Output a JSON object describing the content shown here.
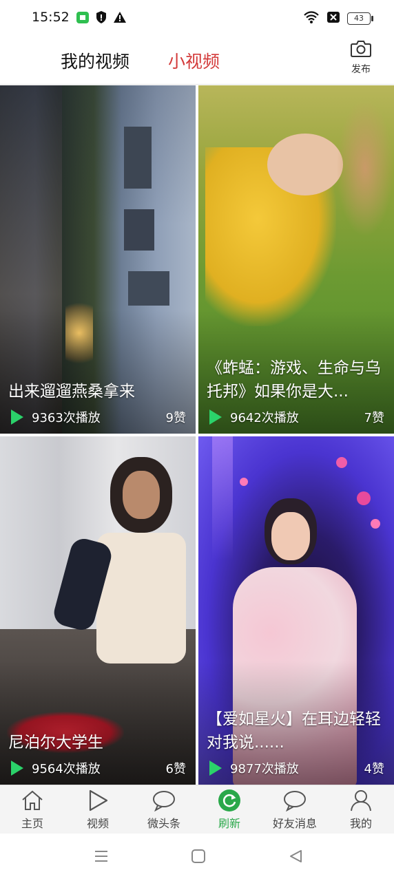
{
  "status_bar": {
    "time": "15:52",
    "battery": "43"
  },
  "header": {
    "tabs": [
      {
        "label": "我的视频",
        "active": false
      },
      {
        "label": "小视频",
        "active": true
      }
    ],
    "publish_label": "发布"
  },
  "videos": [
    {
      "title": "出来遛遛燕桑拿来",
      "plays": "9363次播放",
      "likes": "9赞"
    },
    {
      "title": "《蚱蜢：游戏、生命与乌托邦》如果你是大...",
      "plays": "9642次播放",
      "likes": "7赞"
    },
    {
      "title": "尼泊尔大学生",
      "plays": "9564次播放",
      "likes": "6赞"
    },
    {
      "title": "【爱如星火】在耳边轻轻对我说......",
      "plays": "9877次播放",
      "likes": "4赞"
    }
  ],
  "bottom_nav": [
    {
      "label": "主页",
      "icon": "home-icon"
    },
    {
      "label": "视频",
      "icon": "play-icon"
    },
    {
      "label": "微头条",
      "icon": "chat-bubble-icon"
    },
    {
      "label": "刷新",
      "icon": "refresh-icon",
      "active": true
    },
    {
      "label": "好友消息",
      "icon": "message-icon"
    },
    {
      "label": "我的",
      "icon": "user-icon"
    }
  ],
  "colors": {
    "accent_red": "#d33a3a",
    "accent_green": "#2aa84a",
    "play_green": "#2bd26a"
  }
}
